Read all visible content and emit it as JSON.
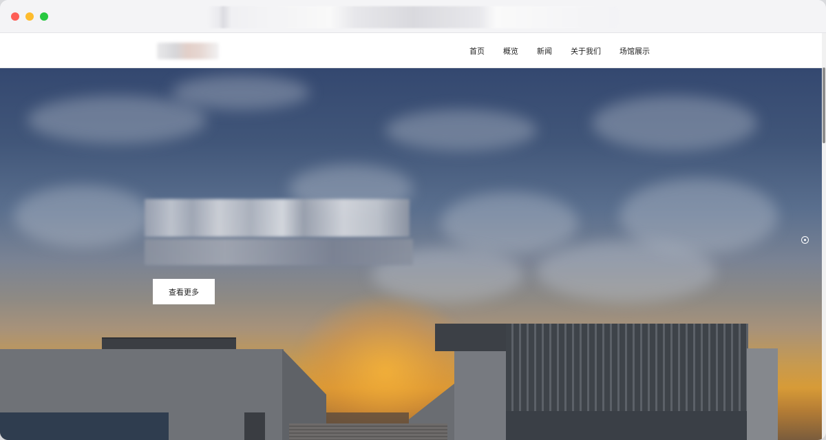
{
  "nav": {
    "items": [
      {
        "label": "首页"
      },
      {
        "label": "概览"
      },
      {
        "label": "新闻"
      },
      {
        "label": "关于我们"
      },
      {
        "label": "场馆展示"
      }
    ]
  },
  "hero": {
    "cta_label": "查看更多",
    "slider_indicator_icon": "circle-dot-icon"
  },
  "window": {
    "controls": [
      "close-icon",
      "minimize-icon",
      "zoom-icon"
    ]
  }
}
